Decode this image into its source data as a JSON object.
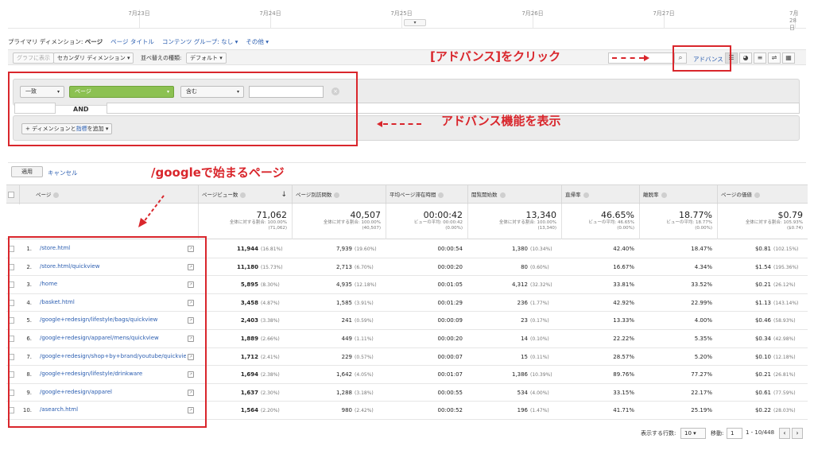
{
  "timeline": {
    "dates": [
      "7月23日",
      "7月24日",
      "7月25日",
      "7月26日",
      "7月27日",
      "7月28日"
    ],
    "handle_icon": "chevron-down"
  },
  "dimension_bar": {
    "label": "プライマリ ディメンション:",
    "active": "ページ",
    "links": [
      "ページ タイトル",
      "コンテンツ グループ: なし ▾",
      "その他 ▾"
    ]
  },
  "toolbar": {
    "chart_button": "グラフに表示",
    "secondary_dimension": "セカンダリ ディメンション ▾",
    "sort_label": "並べ替えの種類:",
    "sort_value": "デフォルト ▾",
    "search_icon": "search-icon",
    "advanced_link": "アドバンス",
    "view_icons": [
      "table-view-icon",
      "pie-view-icon",
      "performance-view-icon",
      "comparison-view-icon",
      "pivot-view-icon"
    ]
  },
  "filter": {
    "match_select": "一致",
    "dimension_select": "ページ",
    "condition_select": "含む",
    "value_input": "",
    "and_label": "AND",
    "add_button_prefix": "+ ディメンションと",
    "add_button_metric": "指標",
    "add_button_suffix": "を追加 ▾"
  },
  "actions": {
    "apply": "適用",
    "cancel": "キャンセル"
  },
  "annotations": {
    "click_advanced": "[アドバンス]をクリック",
    "show_advanced": "アドバンス機能を表示",
    "google_pages": "/googleで始まるページ"
  },
  "table": {
    "headers": [
      "ページ",
      "ページビュー数",
      "ページ別訪問数",
      "平均ページ滞在時間",
      "閲覧開始数",
      "直帰率",
      "離脱率",
      "ページの価値"
    ],
    "sort_arrow": "↓",
    "summary": [
      {
        "big": "71,062",
        "sub1": "全体に対する割合: 100.00%",
        "sub2": "(71,062)"
      },
      {
        "big": "40,507",
        "sub1": "全体に対する割合: 100.00%",
        "sub2": "(40,507)"
      },
      {
        "big": "00:00:42",
        "sub1": "ビューの平均: 00:00:42",
        "sub2": "(0.00%)"
      },
      {
        "big": "13,340",
        "sub1": "全体に対する割合: 100.00%",
        "sub2": "(13,340)"
      },
      {
        "big": "46.65%",
        "sub1": "ビューの平均: 46.65%",
        "sub2": "(0.00%)"
      },
      {
        "big": "18.77%",
        "sub1": "ビューの平均: 18.77%",
        "sub2": "(0.00%)"
      },
      {
        "big": "$0.79",
        "sub1": "全体に対する割合: 105.93%",
        "sub2": "($0.74)"
      }
    ],
    "rows": [
      {
        "idx": "1.",
        "page": "/store.html",
        "pv": "11,944",
        "pv_pct": "(16.81%)",
        "up": "7,939",
        "up_pct": "(19.60%)",
        "time": "00:00:54",
        "ent": "1,380",
        "ent_pct": "(10.34%)",
        "bounce": "42.40%",
        "exit": "18.47%",
        "value": "$0.81",
        "value_pct": "(102.15%)"
      },
      {
        "idx": "2.",
        "page": "/store.html/quickview",
        "pv": "11,180",
        "pv_pct": "(15.73%)",
        "up": "2,713",
        "up_pct": "(6.70%)",
        "time": "00:00:20",
        "ent": "80",
        "ent_pct": "(0.60%)",
        "bounce": "16.67%",
        "exit": "4.34%",
        "value": "$1.54",
        "value_pct": "(195.36%)"
      },
      {
        "idx": "3.",
        "page": "/home",
        "pv": "5,895",
        "pv_pct": "(8.30%)",
        "up": "4,935",
        "up_pct": "(12.18%)",
        "time": "00:01:05",
        "ent": "4,312",
        "ent_pct": "(32.32%)",
        "bounce": "33.81%",
        "exit": "33.52%",
        "value": "$0.21",
        "value_pct": "(26.12%)"
      },
      {
        "idx": "4.",
        "page": "/basket.html",
        "pv": "3,458",
        "pv_pct": "(4.87%)",
        "up": "1,585",
        "up_pct": "(3.91%)",
        "time": "00:01:29",
        "ent": "236",
        "ent_pct": "(1.77%)",
        "bounce": "42.92%",
        "exit": "22.99%",
        "value": "$1.13",
        "value_pct": "(143.14%)"
      },
      {
        "idx": "5.",
        "page": "/google+redesign/lifestyle/bags/quickview",
        "pv": "2,403",
        "pv_pct": "(3.38%)",
        "up": "241",
        "up_pct": "(0.59%)",
        "time": "00:00:09",
        "ent": "23",
        "ent_pct": "(0.17%)",
        "bounce": "13.33%",
        "exit": "4.00%",
        "value": "$0.46",
        "value_pct": "(58.93%)"
      },
      {
        "idx": "6.",
        "page": "/google+redesign/apparel/mens/quickview",
        "pv": "1,889",
        "pv_pct": "(2.66%)",
        "up": "449",
        "up_pct": "(1.11%)",
        "time": "00:00:20",
        "ent": "14",
        "ent_pct": "(0.10%)",
        "bounce": "22.22%",
        "exit": "5.35%",
        "value": "$0.34",
        "value_pct": "(42.98%)"
      },
      {
        "idx": "7.",
        "page": "/google+redesign/shop+by+brand/youtube/quickview",
        "pv": "1,712",
        "pv_pct": "(2.41%)",
        "up": "229",
        "up_pct": "(0.57%)",
        "time": "00:00:07",
        "ent": "15",
        "ent_pct": "(0.11%)",
        "bounce": "28.57%",
        "exit": "5.20%",
        "value": "$0.10",
        "value_pct": "(12.18%)"
      },
      {
        "idx": "8.",
        "page": "/google+redesign/lifestyle/drinkware",
        "pv": "1,694",
        "pv_pct": "(2.38%)",
        "up": "1,642",
        "up_pct": "(4.05%)",
        "time": "00:01:07",
        "ent": "1,386",
        "ent_pct": "(10.39%)",
        "bounce": "89.76%",
        "exit": "77.27%",
        "value": "$0.21",
        "value_pct": "(26.81%)"
      },
      {
        "idx": "9.",
        "page": "/google+redesign/apparel",
        "pv": "1,637",
        "pv_pct": "(2.30%)",
        "up": "1,288",
        "up_pct": "(3.18%)",
        "time": "00:00:55",
        "ent": "534",
        "ent_pct": "(4.00%)",
        "bounce": "33.15%",
        "exit": "22.17%",
        "value": "$0.61",
        "value_pct": "(77.59%)"
      },
      {
        "idx": "10.",
        "page": "/asearch.html",
        "pv": "1,564",
        "pv_pct": "(2.20%)",
        "up": "980",
        "up_pct": "(2.42%)",
        "time": "00:00:52",
        "ent": "196",
        "ent_pct": "(1.47%)",
        "bounce": "41.71%",
        "exit": "25.19%",
        "value": "$0.22",
        "value_pct": "(28.03%)"
      }
    ]
  },
  "pagination": {
    "rows_label": "表示する行数:",
    "rows_value": "10 ▾",
    "goto_label": "移動:",
    "goto_value": "1",
    "range": "1 - 10/448",
    "prev": "‹",
    "next": "›"
  },
  "colors": {
    "annotation_red": "#d9262c",
    "link_blue": "#2a5db0",
    "dimension_green": "#8cc152"
  }
}
